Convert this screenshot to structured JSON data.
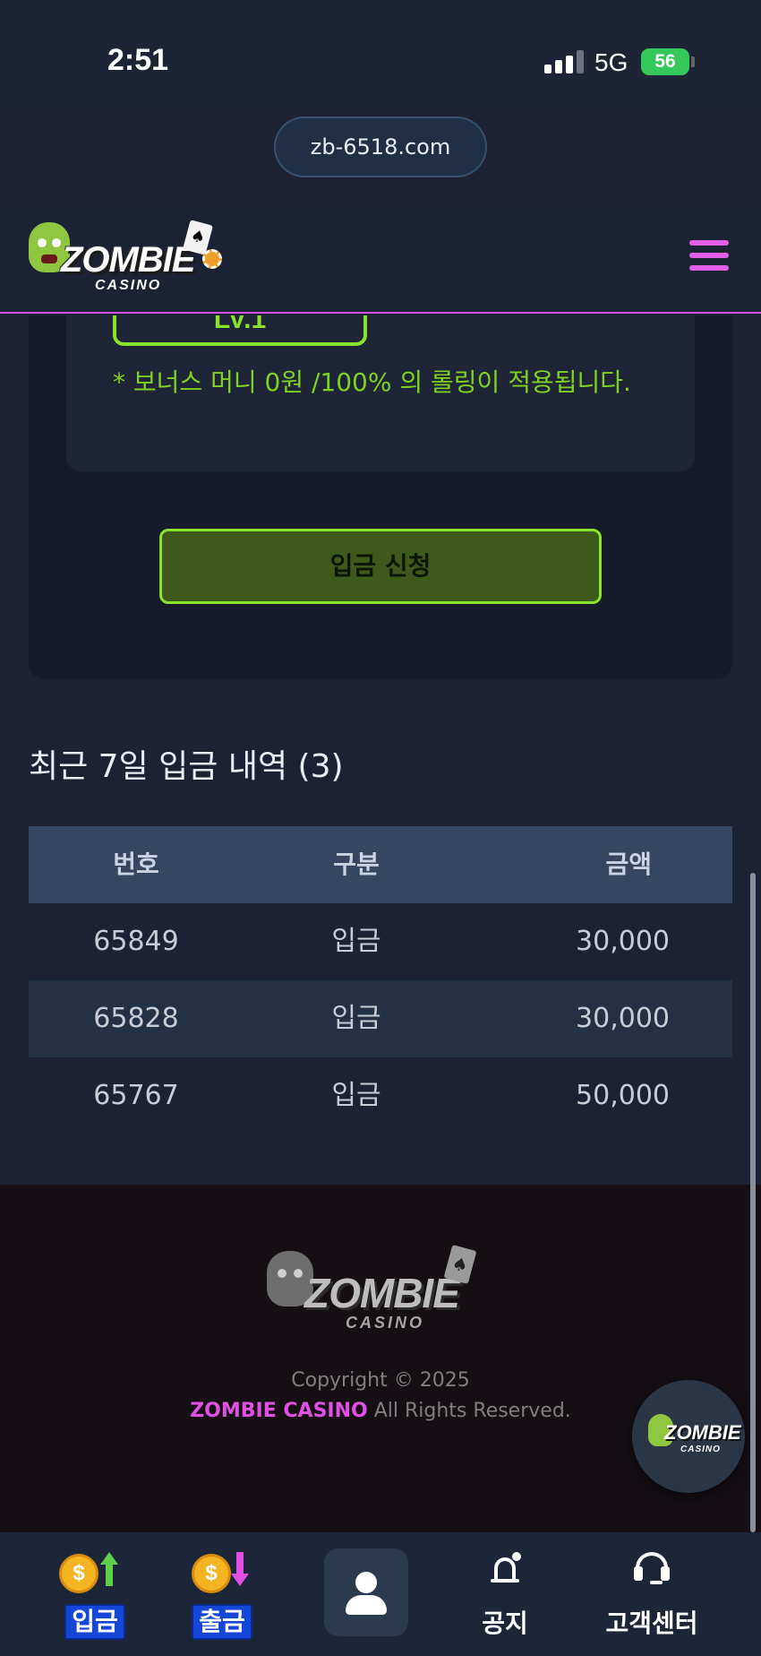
{
  "status_bar": {
    "time": "2:51",
    "network": "5G",
    "battery": "56"
  },
  "browser": {
    "url": "zb-6518.com"
  },
  "header": {
    "logo_main": "ZOMBIE",
    "logo_sub": "CASINO"
  },
  "deposit_card": {
    "level_label": "LV.1",
    "bonus_note": "* 보너스 머니 0원 /100% 의 롤링이 적용됩니다.",
    "submit_label": "입금 신청"
  },
  "history": {
    "title": "최근 7일 입금 내역 (3)",
    "columns": [
      "번호",
      "구분",
      "금액"
    ],
    "rows": [
      {
        "id": "65849",
        "type": "입금",
        "amount": "30,000"
      },
      {
        "id": "65828",
        "type": "입금",
        "amount": "30,000"
      },
      {
        "id": "65767",
        "type": "입금",
        "amount": "50,000"
      }
    ]
  },
  "footer": {
    "logo_main": "ZOMBIE",
    "logo_sub": "CASINO",
    "copyright": "Copyright © 2025",
    "brand": "ZOMBIE CASINO",
    "rights": "All Rights Reserved."
  },
  "float_button": {
    "logo_main": "ZOMBIE",
    "logo_sub": "CASINO"
  },
  "bottom_nav": {
    "deposit": "입금",
    "withdraw": "출금",
    "notice": "공지",
    "support": "고객센터"
  },
  "icons": {
    "coin": "$",
    "card_suit": "♠"
  },
  "colors": {
    "accent_green": "#8be22a",
    "accent_pink": "#e14fe6",
    "background": "#1c2233"
  }
}
